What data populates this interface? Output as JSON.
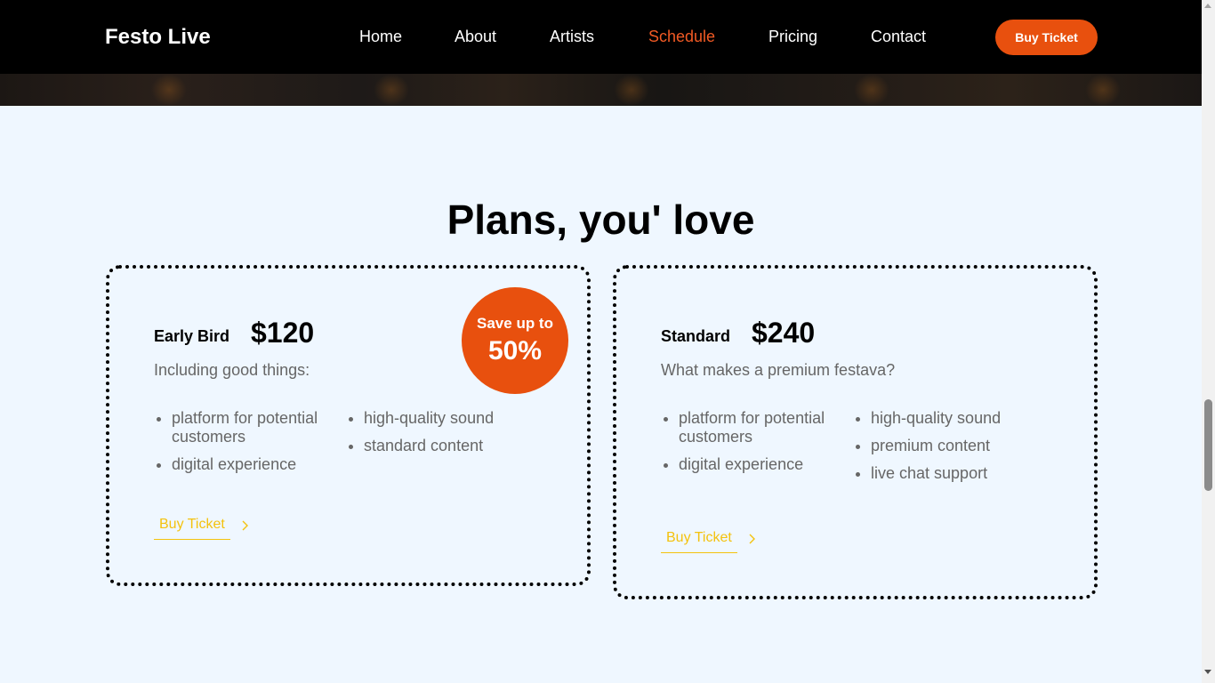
{
  "header": {
    "brand": "Festo Live",
    "nav": [
      {
        "label": "Home",
        "active": false
      },
      {
        "label": "About",
        "active": false
      },
      {
        "label": "Artists",
        "active": false
      },
      {
        "label": "Schedule",
        "active": true
      },
      {
        "label": "Pricing",
        "active": false
      },
      {
        "label": "Contact",
        "active": false
      }
    ],
    "cta_label": "Buy Ticket"
  },
  "pricing": {
    "title": "Plans, you' love",
    "plans": [
      {
        "name": "Early Bird",
        "price": "$120",
        "subtitle": "Including good things:",
        "features_left": [
          "platform for potential customers",
          "digital experience"
        ],
        "features_right": [
          "high-quality sound",
          "standard content"
        ],
        "buy_label": "Buy Ticket"
      },
      {
        "name": "Standard",
        "price": "$240",
        "subtitle": "What makes a premium festava?",
        "features_left": [
          "platform for potential customers",
          "digital experience"
        ],
        "features_right": [
          "high-quality sound",
          "premium content",
          "live chat support"
        ],
        "buy_label": "Buy Ticket"
      }
    ],
    "badge": {
      "line1": "Save up to",
      "line2": "50%"
    }
  },
  "colors": {
    "accent": "#e8500e",
    "active_nav": "#f15a24",
    "link_yellow": "#f4c20d",
    "page_bg": "#eff7ff",
    "navbar_bg": "#000000"
  },
  "icons": {
    "buy_link": "chevron-right-icon"
  }
}
